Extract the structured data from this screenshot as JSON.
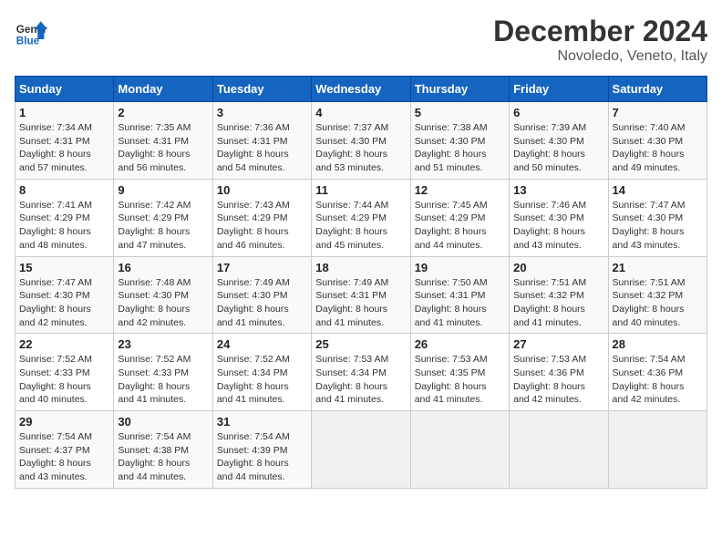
{
  "header": {
    "logo_line1": "General",
    "logo_line2": "Blue",
    "title": "December 2024",
    "subtitle": "Novoledo, Veneto, Italy"
  },
  "days_of_week": [
    "Sunday",
    "Monday",
    "Tuesday",
    "Wednesday",
    "Thursday",
    "Friday",
    "Saturday"
  ],
  "weeks": [
    [
      {
        "day": 1,
        "info": "Sunrise: 7:34 AM\nSunset: 4:31 PM\nDaylight: 8 hours\nand 57 minutes."
      },
      {
        "day": 2,
        "info": "Sunrise: 7:35 AM\nSunset: 4:31 PM\nDaylight: 8 hours\nand 56 minutes."
      },
      {
        "day": 3,
        "info": "Sunrise: 7:36 AM\nSunset: 4:31 PM\nDaylight: 8 hours\nand 54 minutes."
      },
      {
        "day": 4,
        "info": "Sunrise: 7:37 AM\nSunset: 4:30 PM\nDaylight: 8 hours\nand 53 minutes."
      },
      {
        "day": 5,
        "info": "Sunrise: 7:38 AM\nSunset: 4:30 PM\nDaylight: 8 hours\nand 51 minutes."
      },
      {
        "day": 6,
        "info": "Sunrise: 7:39 AM\nSunset: 4:30 PM\nDaylight: 8 hours\nand 50 minutes."
      },
      {
        "day": 7,
        "info": "Sunrise: 7:40 AM\nSunset: 4:30 PM\nDaylight: 8 hours\nand 49 minutes."
      }
    ],
    [
      {
        "day": 8,
        "info": "Sunrise: 7:41 AM\nSunset: 4:29 PM\nDaylight: 8 hours\nand 48 minutes."
      },
      {
        "day": 9,
        "info": "Sunrise: 7:42 AM\nSunset: 4:29 PM\nDaylight: 8 hours\nand 47 minutes."
      },
      {
        "day": 10,
        "info": "Sunrise: 7:43 AM\nSunset: 4:29 PM\nDaylight: 8 hours\nand 46 minutes."
      },
      {
        "day": 11,
        "info": "Sunrise: 7:44 AM\nSunset: 4:29 PM\nDaylight: 8 hours\nand 45 minutes."
      },
      {
        "day": 12,
        "info": "Sunrise: 7:45 AM\nSunset: 4:29 PM\nDaylight: 8 hours\nand 44 minutes."
      },
      {
        "day": 13,
        "info": "Sunrise: 7:46 AM\nSunset: 4:30 PM\nDaylight: 8 hours\nand 43 minutes."
      },
      {
        "day": 14,
        "info": "Sunrise: 7:47 AM\nSunset: 4:30 PM\nDaylight: 8 hours\nand 43 minutes."
      }
    ],
    [
      {
        "day": 15,
        "info": "Sunrise: 7:47 AM\nSunset: 4:30 PM\nDaylight: 8 hours\nand 42 minutes."
      },
      {
        "day": 16,
        "info": "Sunrise: 7:48 AM\nSunset: 4:30 PM\nDaylight: 8 hours\nand 42 minutes."
      },
      {
        "day": 17,
        "info": "Sunrise: 7:49 AM\nSunset: 4:30 PM\nDaylight: 8 hours\nand 41 minutes."
      },
      {
        "day": 18,
        "info": "Sunrise: 7:49 AM\nSunset: 4:31 PM\nDaylight: 8 hours\nand 41 minutes."
      },
      {
        "day": 19,
        "info": "Sunrise: 7:50 AM\nSunset: 4:31 PM\nDaylight: 8 hours\nand 41 minutes."
      },
      {
        "day": 20,
        "info": "Sunrise: 7:51 AM\nSunset: 4:32 PM\nDaylight: 8 hours\nand 41 minutes."
      },
      {
        "day": 21,
        "info": "Sunrise: 7:51 AM\nSunset: 4:32 PM\nDaylight: 8 hours\nand 40 minutes."
      }
    ],
    [
      {
        "day": 22,
        "info": "Sunrise: 7:52 AM\nSunset: 4:33 PM\nDaylight: 8 hours\nand 40 minutes."
      },
      {
        "day": 23,
        "info": "Sunrise: 7:52 AM\nSunset: 4:33 PM\nDaylight: 8 hours\nand 41 minutes."
      },
      {
        "day": 24,
        "info": "Sunrise: 7:52 AM\nSunset: 4:34 PM\nDaylight: 8 hours\nand 41 minutes."
      },
      {
        "day": 25,
        "info": "Sunrise: 7:53 AM\nSunset: 4:34 PM\nDaylight: 8 hours\nand 41 minutes."
      },
      {
        "day": 26,
        "info": "Sunrise: 7:53 AM\nSunset: 4:35 PM\nDaylight: 8 hours\nand 41 minutes."
      },
      {
        "day": 27,
        "info": "Sunrise: 7:53 AM\nSunset: 4:36 PM\nDaylight: 8 hours\nand 42 minutes."
      },
      {
        "day": 28,
        "info": "Sunrise: 7:54 AM\nSunset: 4:36 PM\nDaylight: 8 hours\nand 42 minutes."
      }
    ],
    [
      {
        "day": 29,
        "info": "Sunrise: 7:54 AM\nSunset: 4:37 PM\nDaylight: 8 hours\nand 43 minutes."
      },
      {
        "day": 30,
        "info": "Sunrise: 7:54 AM\nSunset: 4:38 PM\nDaylight: 8 hours\nand 44 minutes."
      },
      {
        "day": 31,
        "info": "Sunrise: 7:54 AM\nSunset: 4:39 PM\nDaylight: 8 hours\nand 44 minutes."
      },
      null,
      null,
      null,
      null
    ]
  ]
}
